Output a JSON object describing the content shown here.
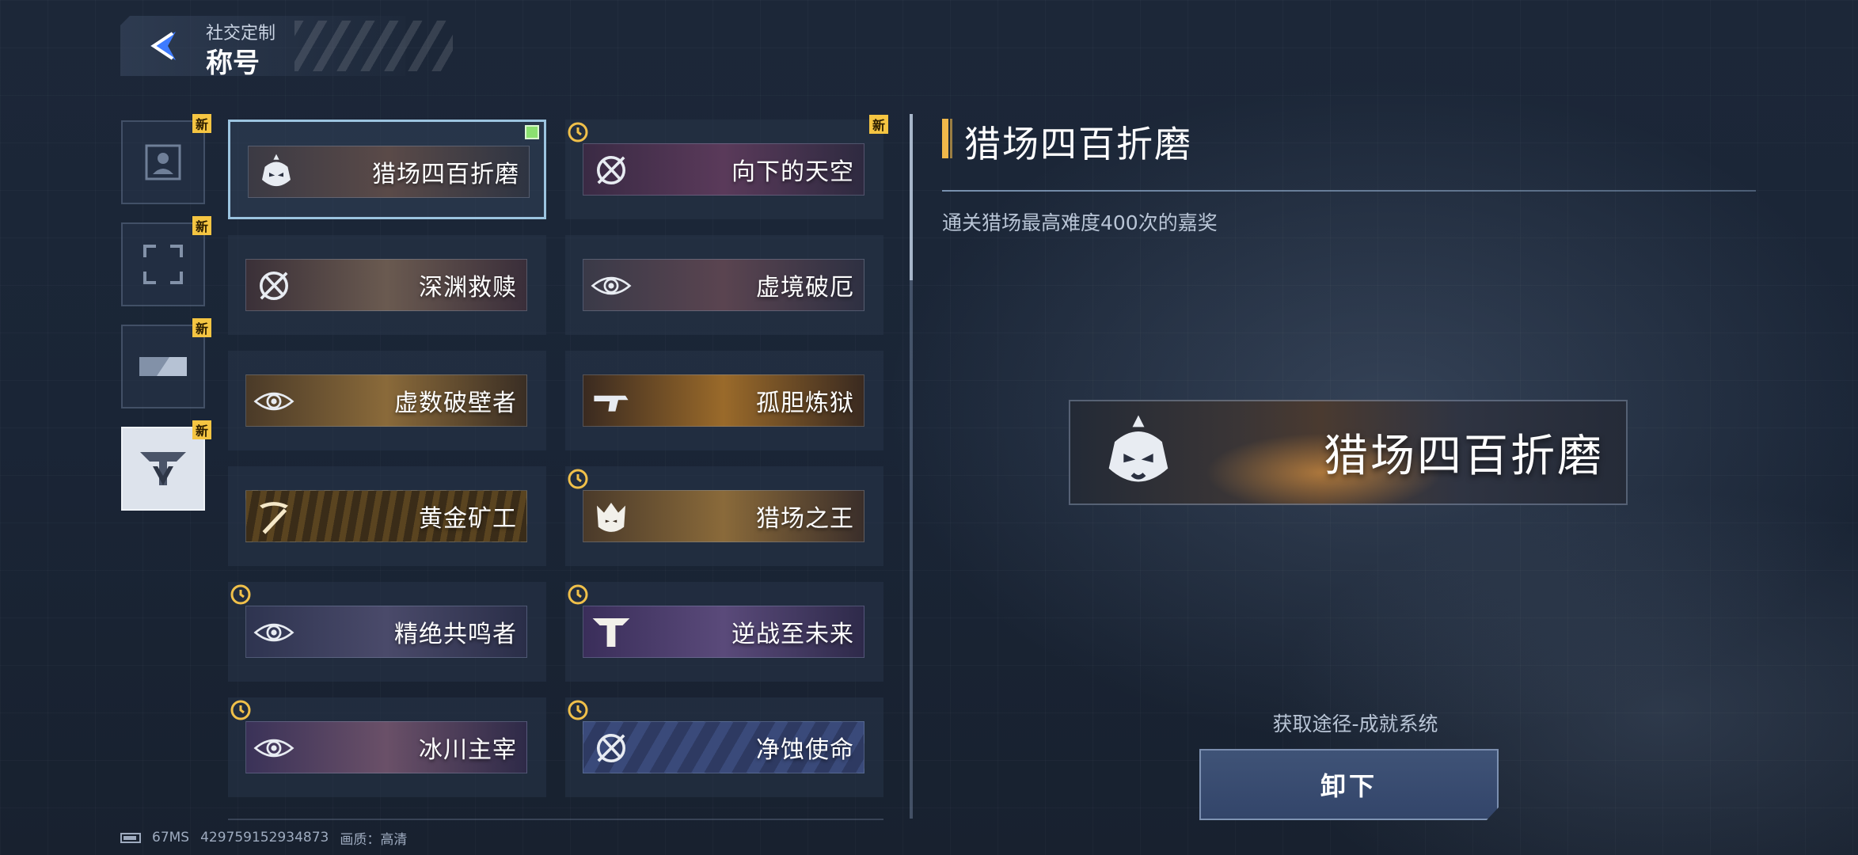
{
  "header": {
    "subtitle": "社交定制",
    "title": "称号"
  },
  "tabs": [
    {
      "icon": "avatar-icon",
      "badge": "新",
      "active": false
    },
    {
      "icon": "frame-icon",
      "badge": "新",
      "active": false
    },
    {
      "icon": "card-icon",
      "badge": "新",
      "active": false
    },
    {
      "icon": "title-emblem-icon",
      "badge": "新",
      "active": true
    }
  ],
  "titles": [
    {
      "name": "猎场四百折磨",
      "emblem": "helmet-emblem-icon",
      "selected": true,
      "equipped": true,
      "timed": false,
      "new": false
    },
    {
      "name": "向下的天空",
      "emblem": "crossed-circle-emblem-icon",
      "selected": false,
      "timed": true,
      "new": true
    },
    {
      "name": "深渊救赎",
      "emblem": "crossed-circle-emblem-icon",
      "selected": false,
      "timed": false,
      "new": false
    },
    {
      "name": "虚境破厄",
      "emblem": "eye-emblem-icon",
      "selected": false,
      "timed": false,
      "new": false
    },
    {
      "name": "虚数破壁者",
      "emblem": "eye-emblem-icon",
      "selected": false,
      "timed": false,
      "new": false
    },
    {
      "name": "孤胆炼狱",
      "emblem": "gun-emblem-icon",
      "selected": false,
      "timed": false,
      "new": false
    },
    {
      "name": "黄金矿工",
      "emblem": "pickaxe-emblem-icon",
      "selected": false,
      "timed": false,
      "new": false
    },
    {
      "name": "猎场之王",
      "emblem": "lion-emblem-icon",
      "selected": false,
      "timed": true,
      "new": false
    },
    {
      "name": "精绝共鸣者",
      "emblem": "eye-emblem-icon",
      "selected": false,
      "timed": true,
      "new": false
    },
    {
      "name": "逆战至未来",
      "emblem": "nz-logo-emblem-icon",
      "selected": false,
      "timed": true,
      "new": false
    },
    {
      "name": "冰川主宰",
      "emblem": "eye-emblem-icon",
      "selected": false,
      "timed": true,
      "new": false
    },
    {
      "name": "净蚀使命",
      "emblem": "crossed-circle-emblem-icon",
      "selected": false,
      "timed": true,
      "new": false
    }
  ],
  "detail": {
    "title": "猎场四百折磨",
    "description": "通关猎场最高难度400次的嘉奖",
    "preview_name": "猎场四百折磨",
    "source": "获取途径-成就系统",
    "button_label": "卸下"
  },
  "footer": {
    "ping": "67MS",
    "id": "429759152934873",
    "quality": "画质：高清"
  },
  "colors": {
    "accent_gold": "#f0b84a",
    "badge_new": "#f5c542",
    "selected_border": "#9cc4e0",
    "equipped_green": "#8be070",
    "button_blue": "#3f5377"
  }
}
